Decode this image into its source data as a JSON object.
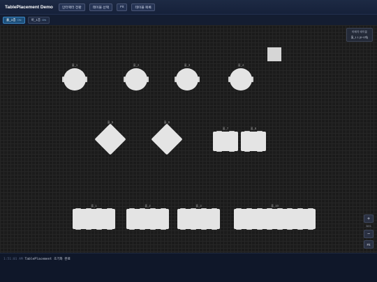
{
  "header": {
    "app_title": "TablePlacement Demo",
    "buttons": [
      "인터랙터 전환",
      "테이블 선택",
      "Fit",
      "테이블 목록"
    ]
  },
  "subbar": {
    "modes": [
      {
        "label": "홀_1층",
        "sub": "ON",
        "active": true
      },
      {
        "label": "바_1층",
        "sub": "ON",
        "active": false
      }
    ]
  },
  "canvas": {
    "info_panel": {
      "title": "미배치 테이블",
      "value": "홀_1 1 (0~0개)"
    },
    "zoom": {
      "zoom_in": "+",
      "level": "96%",
      "zoom_out": "−",
      "fit": "Fit"
    },
    "tables": [
      {
        "label": "홀_1",
        "shape": "round"
      },
      {
        "label": "홀_2",
        "shape": "round"
      },
      {
        "label": "홀_3",
        "shape": "round"
      },
      {
        "label": "홀_4",
        "shape": "round"
      },
      {
        "label": "홀_5",
        "shape": "diamond"
      },
      {
        "label": "홀_6",
        "shape": "diamond"
      },
      {
        "label": "홀_7",
        "shape": "square"
      },
      {
        "label": "홀_8",
        "shape": "square"
      },
      {
        "label": "홀_1",
        "shape": "rect"
      },
      {
        "label": "홀_2",
        "shape": "rect"
      },
      {
        "label": "홀_3",
        "shape": "rect"
      },
      {
        "label": "홀_10",
        "shape": "rect"
      }
    ]
  },
  "status": {
    "time": "1:51:01 AM",
    "message": "TablePlacement 초기화 완료"
  }
}
